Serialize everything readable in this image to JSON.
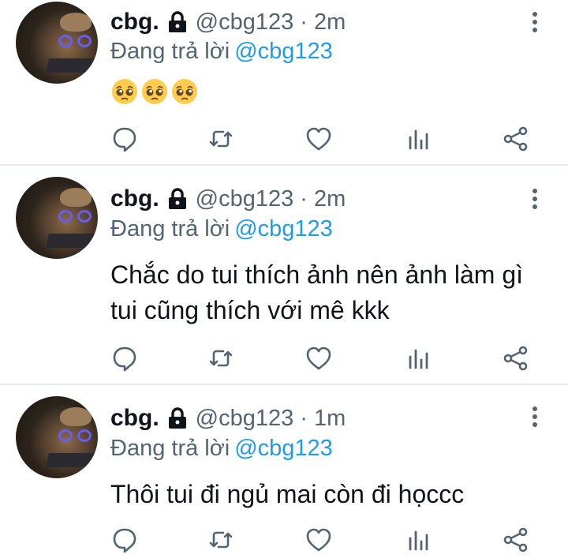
{
  "tweets": [
    {
      "name": "cbg.",
      "handle": "@cbg123",
      "separator": "·",
      "time": "2m",
      "reply_prefix": "Đang trả lời",
      "reply_to": "@cbg123",
      "text": "",
      "emojis": [
        "pleading-face",
        "pleading-face",
        "pleading-face"
      ]
    },
    {
      "name": "cbg.",
      "handle": "@cbg123",
      "separator": "·",
      "time": "2m",
      "reply_prefix": "Đang trả lời",
      "reply_to": "@cbg123",
      "text": "Chắc do tui thích ảnh nên ảnh làm gì tui cũng thích với mê kkk",
      "emojis": []
    },
    {
      "name": "cbg.",
      "handle": "@cbg123",
      "separator": "·",
      "time": "1m",
      "reply_prefix": "Đang trả lời",
      "reply_to": "@cbg123",
      "text": "Thôi tui đi ngủ mai còn đi họccc",
      "emojis": []
    }
  ],
  "actions": [
    "reply-icon",
    "retweet-icon",
    "like-icon",
    "analytics-icon",
    "share-icon"
  ],
  "colors": {
    "text": "#0f1419",
    "secondary": "#536471",
    "mention": "#1d9bf0",
    "separator": "#e6e9ec"
  }
}
